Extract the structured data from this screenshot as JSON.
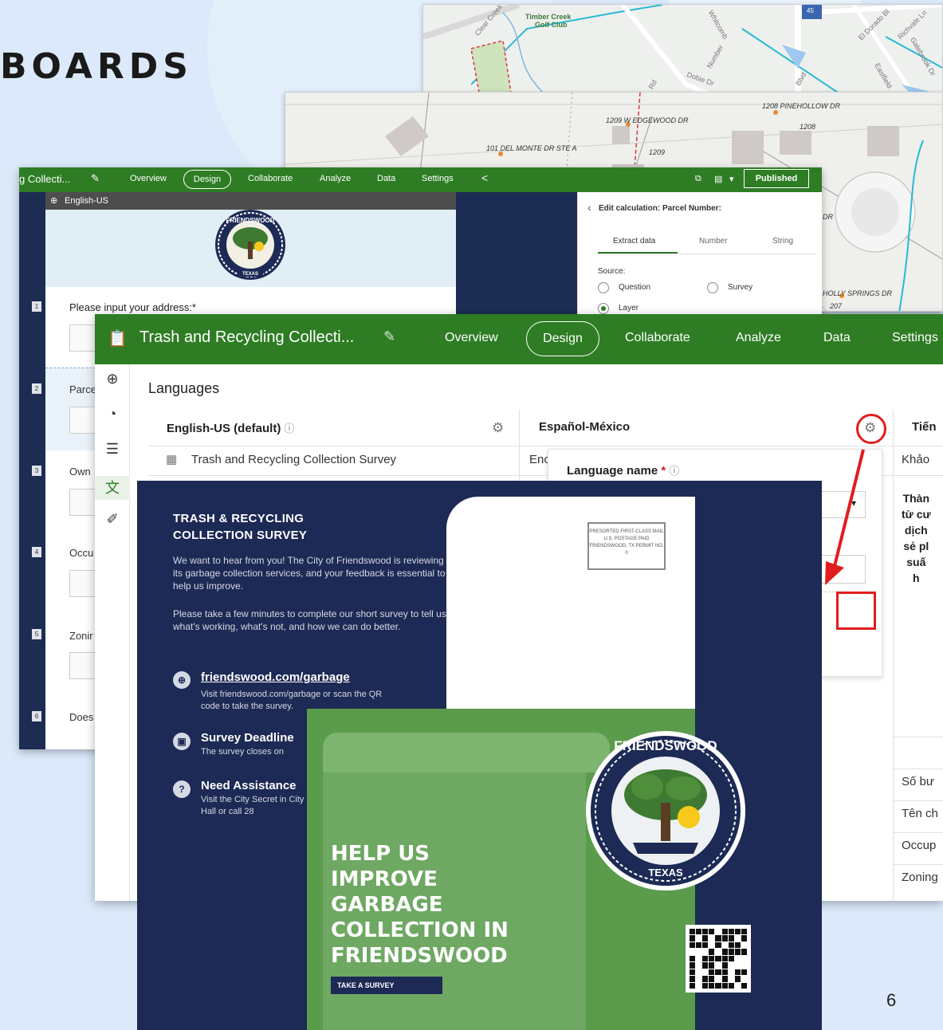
{
  "slide": {
    "title": "BOARDS",
    "page_number": "6"
  },
  "map1": {
    "labels": [
      "Timber Creek",
      "Golf Club",
      "Clear Creek",
      "Whitcomb",
      "Number",
      "Dobie Dr",
      "Eastfield",
      "Richvale Ln",
      "El Dorado Bl",
      "Gatebrook Dr",
      "Blvd",
      "Rd",
      "45"
    ]
  },
  "map2": {
    "labels": [
      "1208 PINEHOLLOW DR",
      "1208",
      "1209 W EDGEWOOD DR",
      "1209",
      "101 DEL MONTE DR STE A",
      "DR",
      "HOLLY SPRINGS DR",
      "207"
    ]
  },
  "designer": {
    "app_title": "g Collecti...",
    "nav": [
      "Overview",
      "Design",
      "Collaborate",
      "Analyze",
      "Data",
      "Settings"
    ],
    "published_label": "Published",
    "language": "English-US",
    "questions": [
      {
        "num": "1",
        "label": "Please input your address:*"
      },
      {
        "num": "2",
        "label": "Parce"
      },
      {
        "num": "3",
        "label": "Own"
      },
      {
        "num": "4",
        "label": "Occu"
      },
      {
        "num": "5",
        "label": "Zonir"
      },
      {
        "num": "6",
        "label": "Does"
      }
    ],
    "panel": {
      "header": "Edit calculation: Parcel Number:",
      "tabs": [
        "Extract data",
        "Number",
        "String"
      ],
      "source_label": "Source:",
      "options": [
        "Question",
        "Survey",
        "Layer"
      ],
      "selected": "Layer"
    },
    "logo_text": "FRIENDSWOOD",
    "logo_sub": "TEXAS"
  },
  "survey123": {
    "app_title": "Trash and Recycling Collecti...",
    "nav": [
      "Overview",
      "Design",
      "Collaborate",
      "Analyze",
      "Data",
      "Settings"
    ],
    "active_nav": "Design",
    "heading": "Languages",
    "columns": [
      "English-US (default)",
      "Español-México",
      "Tiến"
    ],
    "rows": [
      {
        "en": "Trash and Recycling Collection Survey",
        "es": "Enc",
        "vi": "Khảo"
      }
    ],
    "popover": {
      "label": "Language name",
      "required": "*"
    },
    "vietnamese_desc": [
      "Thàn",
      "từ cư",
      "dịch",
      "sẻ pl",
      "suấ",
      "h"
    ],
    "right_cells": [
      "Số bư",
      "Tên ch",
      "Occup",
      "Zoning"
    ]
  },
  "postcard": {
    "heading_line1": "TRASH & RECYCLING",
    "heading_line2": "COLLECTION SURVEY",
    "intro": "We want to hear from you! The City of Friendswood is reviewing its garbage collection services, and your feedback is essential to help us improve.",
    "intro2": "Please take a few minutes to complete our short survey to tell us what's working, what's not, and how we can do better.",
    "link": "friendswood.com/garbage",
    "link_sub": "Visit friendswood.com/garbage or scan the QR code to take the survey.",
    "deadline_title": "Survey Deadline",
    "deadline_sub": "The survey closes on",
    "assist_title": "Need Assistance",
    "assist_sub": "Visit the City Secret in City Hall or call 28",
    "stamp_text": "PRESORTED FIRST-CLASS MAIL U.S. POSTAGE PAID FRIENDSWOOD, TX PERMIT NO. 0",
    "big_line1": "HELP US",
    "big_line2": "IMPROVE",
    "big_line3": "GARBAGE",
    "big_line4": "COLLECTION IN",
    "big_line5": "FRIENDSWOOD",
    "button": "TAKE A SURVEY",
    "seal_text": "FRIENDSWOOD",
    "seal_sub": "TEXAS"
  },
  "colors": {
    "survey_green": "#2e7d24",
    "navy": "#1d2a55",
    "annotation_red": "#e21d1d",
    "background": "#dbe9fa"
  }
}
